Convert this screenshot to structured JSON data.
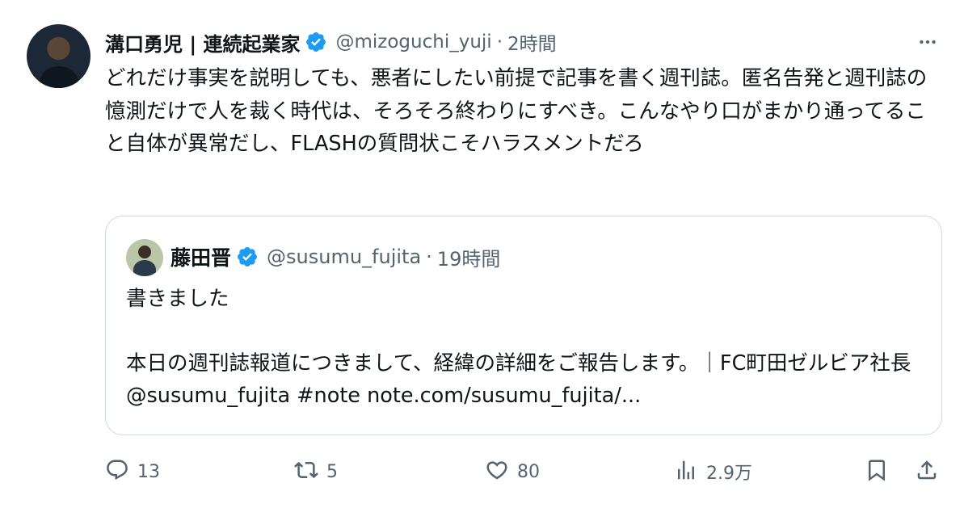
{
  "post": {
    "author": {
      "name": "溝口勇児 | 連続起業家",
      "handle": "@mizoguchi_yuji",
      "separator": "·",
      "time": "2時間"
    },
    "text": "どれだけ事実を説明しても、悪者にしたい前提で記事を書く週刊誌。匿名告発と週刊誌の憶測だけで人を裁く時代は、そろそろ終わりにすべき。こんなやり口がまかり通ってること自体が異常だし、FLASHの質問状こそハラスメントだろ"
  },
  "quote": {
    "author": {
      "name": "藤田晋",
      "handle": "@susumu_fujita",
      "separator": "·",
      "time": "19時間"
    },
    "line1": "書きました",
    "line2": "本日の週刊誌報道につきまして、経緯の詳細をご報告します。｜FC町田ゼルビア社長 @susumu_fujita #note note.com/susumu_fujita/..."
  },
  "actions": {
    "reply_count": "13",
    "retweet_count": "5",
    "like_count": "80",
    "views_count": "2.9万"
  },
  "icons": {
    "verified": "verified-badge-icon",
    "more": "more-dots-icon",
    "reply": "reply-icon",
    "retweet": "retweet-icon",
    "like": "heart-icon",
    "views": "views-chart-icon",
    "bookmark": "bookmark-icon",
    "share": "share-icon"
  },
  "colors": {
    "verified_blue": "#1d9bf0",
    "secondary_text": "#536471",
    "primary_text": "#0f1419",
    "border": "#cfd9de"
  }
}
